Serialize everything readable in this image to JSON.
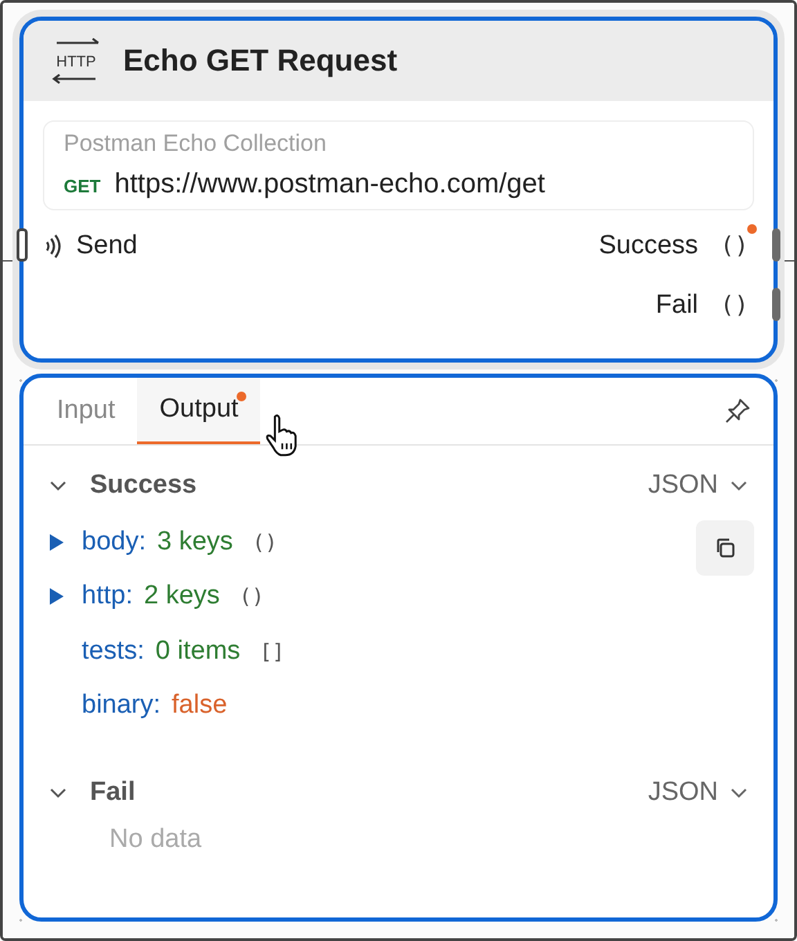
{
  "node": {
    "icon_text": "HTTP",
    "title": "Echo GET Request",
    "collection": "Postman Echo Collection",
    "method": "GET",
    "url": "https://www.postman-echo.com/get",
    "inputs": [
      {
        "label": "Send"
      }
    ],
    "outputs": [
      {
        "label": "Success",
        "brackets": "()",
        "has_new": true
      },
      {
        "label": "Fail",
        "brackets": "()",
        "has_new": false
      }
    ]
  },
  "panel": {
    "tabs": [
      {
        "label": "Input",
        "selected": false,
        "has_new": false
      },
      {
        "label": "Output",
        "selected": true,
        "has_new": true
      }
    ],
    "sections": [
      {
        "title": "Success",
        "expanded": true,
        "format": "JSON",
        "rows": [
          {
            "kind": "object",
            "key": "body:",
            "value": "3 keys",
            "brackets": "()",
            "expanded": false
          },
          {
            "kind": "object",
            "key": "http:",
            "value": "2 keys",
            "brackets": "()",
            "expanded": false
          },
          {
            "kind": "array",
            "key": "tests:",
            "value": "0 items",
            "brackets": "[]"
          },
          {
            "kind": "boolean",
            "key": "binary:",
            "value": "false"
          }
        ]
      },
      {
        "title": "Fail",
        "expanded": true,
        "format": "JSON",
        "empty_text": "No data"
      }
    ]
  }
}
